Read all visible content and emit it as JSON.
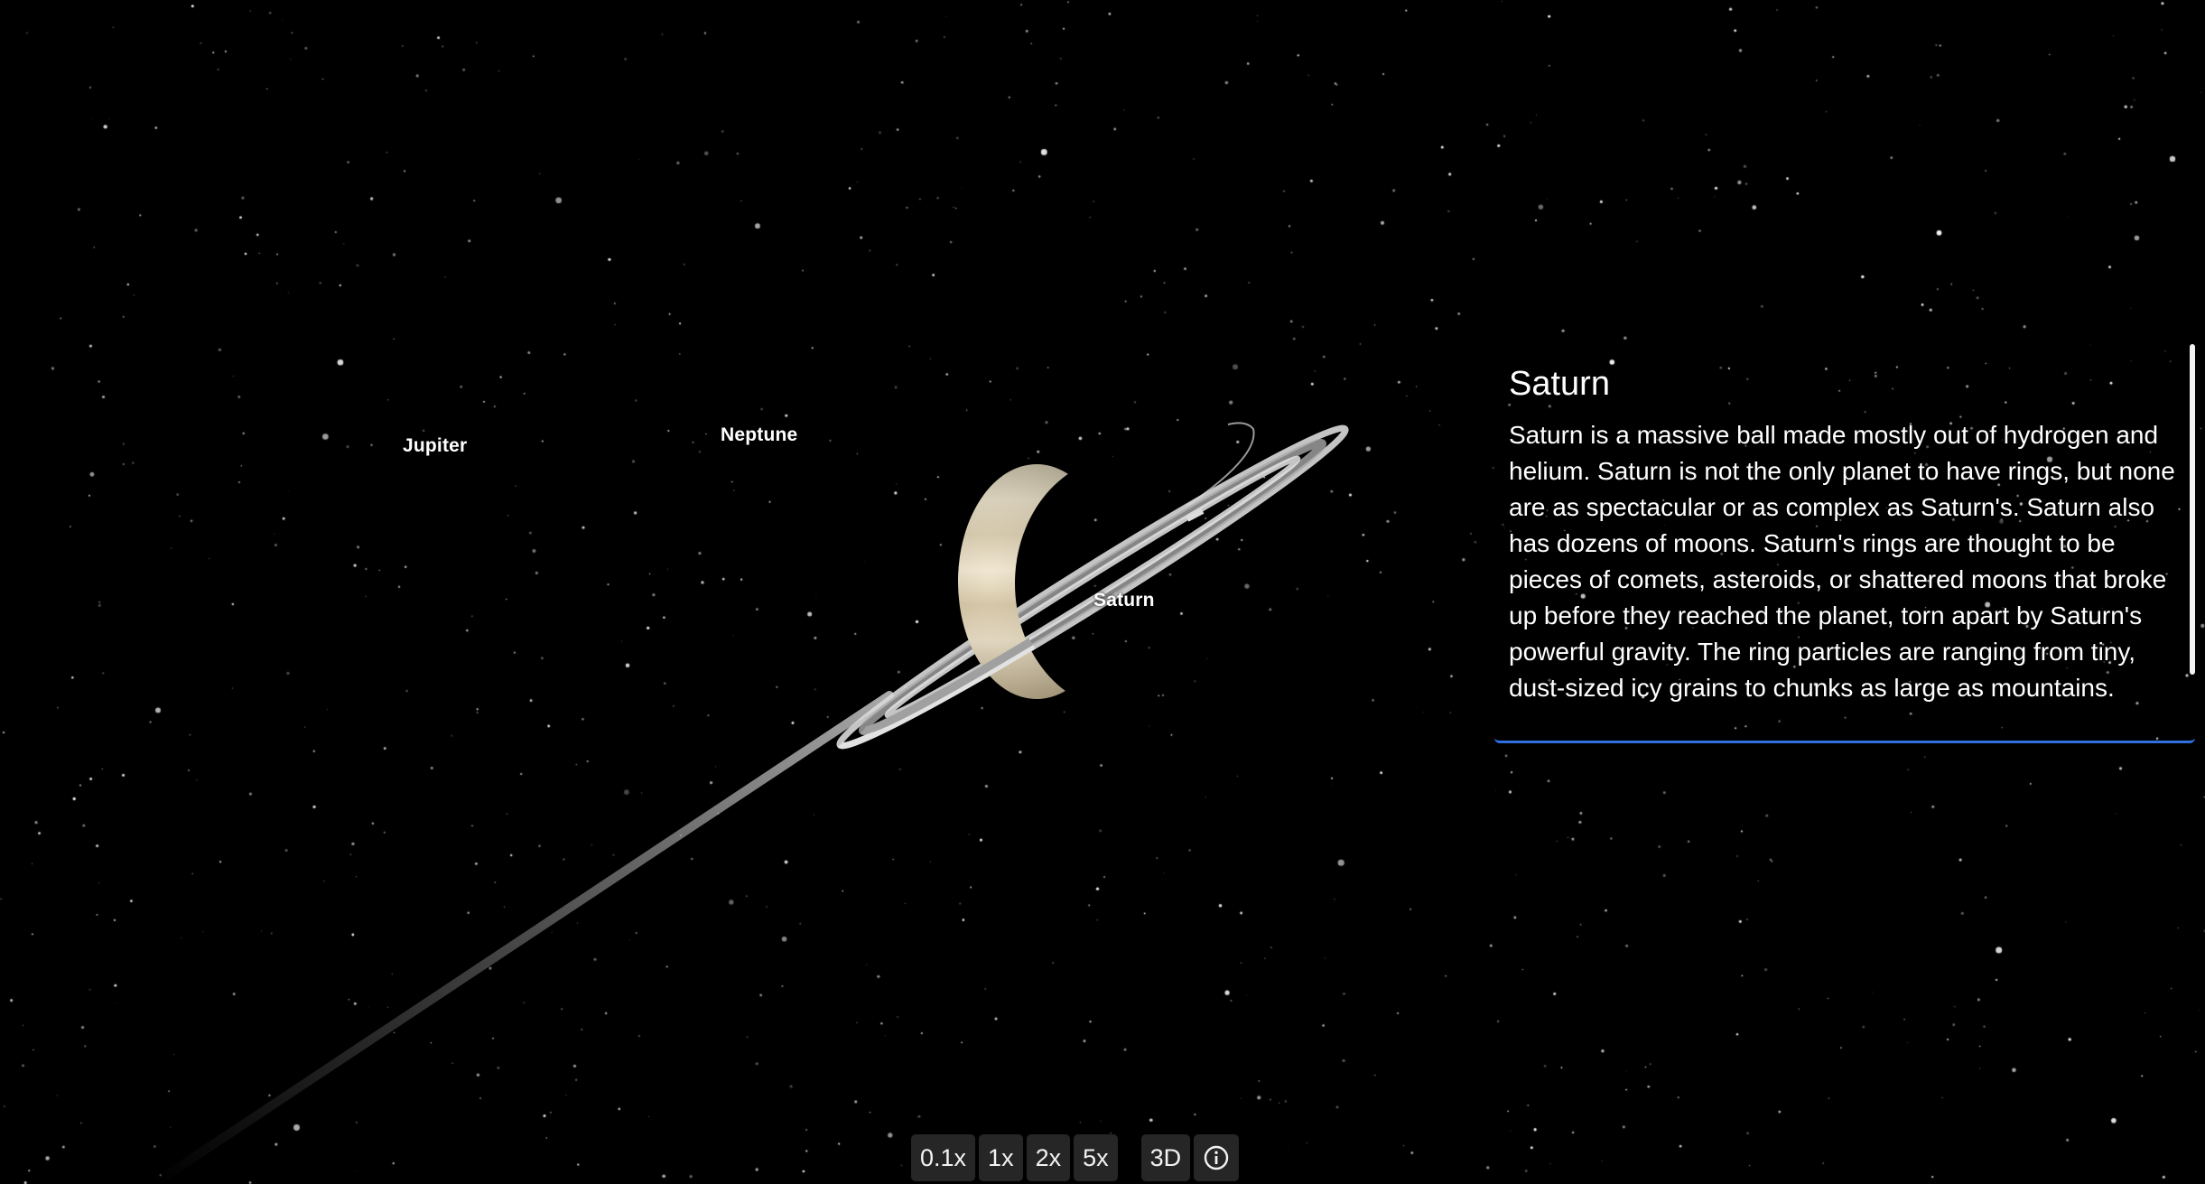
{
  "scene": {
    "labels": {
      "jupiter": "Jupiter",
      "neptune": "Neptune",
      "saturn": "Saturn"
    },
    "background_color": "#000000"
  },
  "info_panel": {
    "title": "Saturn",
    "body": "Saturn is a massive ball made mostly out of hydrogen and helium. Saturn is not the only planet to have rings, but none are as spectacular or as complex as Saturn's. Saturn also has dozens of moons. Saturn's rings are thought to be pieces of comets, asteroids, or shattered moons that broke up before they reached the planet, torn apart by Saturn's powerful gravity. The ring particles are ranging from tiny, dust-sized icy grains to chunks as large as mountains.",
    "accent_color": "#2f6fe0"
  },
  "toolbar": {
    "speed_buttons": [
      "0.1x",
      "1x",
      "2x",
      "5x"
    ],
    "view_button": "3D",
    "info_icon": "info-icon"
  }
}
